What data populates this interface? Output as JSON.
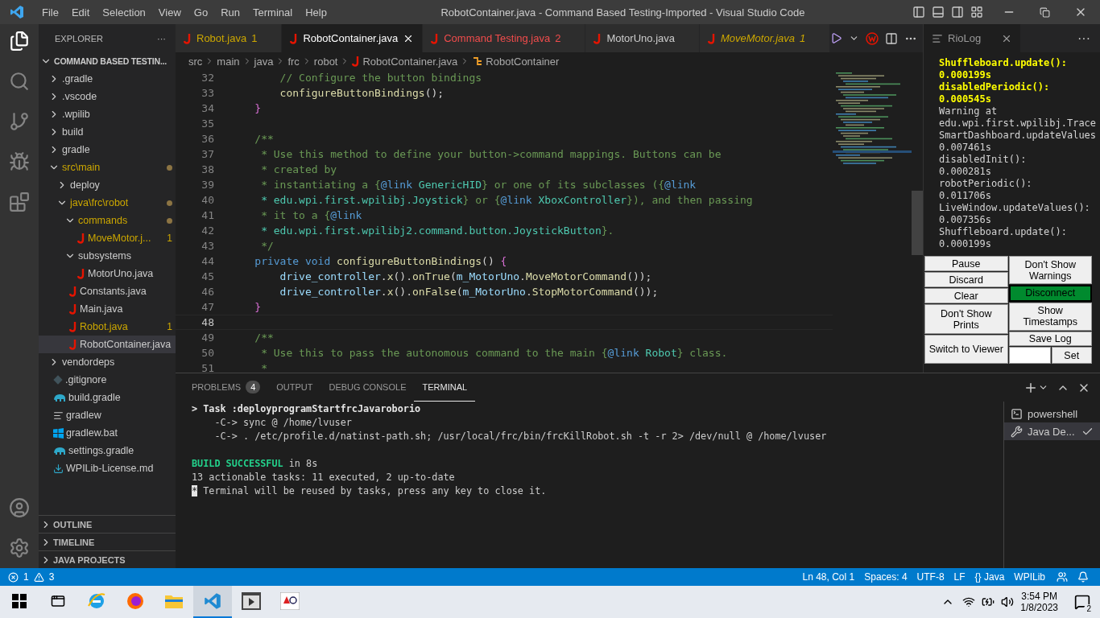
{
  "title_bar": {
    "menus": [
      "File",
      "Edit",
      "Selection",
      "View",
      "Go",
      "Run",
      "Terminal",
      "Help"
    ],
    "title": "RobotContainer.java - Command Based Testing-Imported - Visual Studio Code"
  },
  "explorer": {
    "title": "EXPLORER",
    "more": "···",
    "root": {
      "label": "COMMAND BASED TESTIN...",
      "expanded": true
    },
    "tree": [
      {
        "label": ".gradle",
        "kind": "folder",
        "expanded": false,
        "modified": false,
        "selected": false
      },
      {
        "label": ".vscode",
        "kind": "folder",
        "expanded": false,
        "modified": false,
        "selected": false
      },
      {
        "label": ".wpilib",
        "kind": "folder",
        "expanded": false,
        "modified": false,
        "selected": false
      },
      {
        "label": "build",
        "kind": "folder",
        "expanded": false,
        "modified": false,
        "selected": false
      },
      {
        "label": "gradle",
        "kind": "folder",
        "expanded": false,
        "modified": false,
        "selected": false
      },
      {
        "label": "src\\main",
        "kind": "folder",
        "expanded": true,
        "modified": true,
        "selected": false,
        "children": [
          {
            "label": "deploy",
            "kind": "folder",
            "expanded": false,
            "modified": false,
            "selected": false
          },
          {
            "label": "java\\frc\\robot",
            "kind": "folder",
            "expanded": true,
            "modified": true,
            "selected": false,
            "children": [
              {
                "label": "commands",
                "kind": "folder",
                "expanded": true,
                "modified": true,
                "selected": false,
                "children": [
                  {
                    "label": "MoveMotor.j...",
                    "kind": "java",
                    "modified": true,
                    "badge": "1",
                    "selected": false
                  }
                ]
              },
              {
                "label": "subsystems",
                "kind": "folder",
                "expanded": true,
                "modified": false,
                "selected": false,
                "children": [
                  {
                    "label": "MotorUno.java",
                    "kind": "java",
                    "modified": false,
                    "selected": false
                  }
                ]
              },
              {
                "label": "Constants.java",
                "kind": "java",
                "modified": false,
                "selected": false
              },
              {
                "label": "Main.java",
                "kind": "java",
                "modified": false,
                "selected": false
              },
              {
                "label": "Robot.java",
                "kind": "java",
                "modified": true,
                "badge": "1",
                "selected": false
              },
              {
                "label": "RobotContainer.java",
                "kind": "java",
                "modified": false,
                "selected": true
              }
            ]
          }
        ]
      },
      {
        "label": "vendordeps",
        "kind": "folder",
        "expanded": false,
        "modified": false,
        "selected": false
      },
      {
        "label": ".gitignore",
        "kind": "git",
        "modified": false,
        "selected": false
      },
      {
        "label": "build.gradle",
        "kind": "gradle",
        "modified": false,
        "selected": false
      },
      {
        "label": "gradlew",
        "kind": "text",
        "modified": false,
        "selected": false
      },
      {
        "label": "gradlew.bat",
        "kind": "windows",
        "modified": false,
        "selected": false
      },
      {
        "label": "settings.gradle",
        "kind": "gradle",
        "modified": false,
        "selected": false
      },
      {
        "label": "WPILib-License.md",
        "kind": "download",
        "modified": false,
        "selected": false
      }
    ],
    "sections": [
      {
        "label": "OUTLINE",
        "expanded": false
      },
      {
        "label": "TIMELINE",
        "expanded": false
      },
      {
        "label": "JAVA PROJECTS",
        "expanded": false
      }
    ]
  },
  "tabs": [
    {
      "label": "Robot.java",
      "badge": "1",
      "color": "#cca700",
      "preview": false,
      "selected": false
    },
    {
      "label": "RobotContainer.java",
      "color": "#ffffff",
      "preview": false,
      "selected": true
    },
    {
      "label": "Command Testing.java",
      "badge": "2",
      "color": "#f14c4c",
      "preview": false,
      "selected": false
    },
    {
      "label": "MotorUno.java",
      "color": "#cccccc",
      "preview": false,
      "selected": false
    },
    {
      "label": "MoveMotor.java",
      "badge": "1",
      "color": "#cca700",
      "preview": true,
      "selected": false
    }
  ],
  "breadcrumb": [
    "src",
    "main",
    "java",
    "frc",
    "robot",
    "RobotContainer.java",
    "RobotContainer"
  ],
  "code": [
    {
      "number": "32",
      "current": false,
      "segments": [
        {
          "text": "        // Configure the button bindings",
          "kind": "comment"
        }
      ]
    },
    {
      "number": "33",
      "current": false,
      "segments": [
        {
          "text": "        configureButtonBindings",
          "kind": "method"
        },
        {
          "text": "();",
          "kind": "plain"
        }
      ]
    },
    {
      "number": "34",
      "current": false,
      "segments": [
        {
          "text": "    }",
          "kind": "brace"
        }
      ]
    },
    {
      "number": "35",
      "current": false
    },
    {
      "number": "36",
      "current": false,
      "segments": [
        {
          "text": "    /**",
          "kind": "comment"
        }
      ]
    },
    {
      "number": "37",
      "current": false,
      "segments": [
        {
          "text": "     * Use this method to define your button->command mappings. Buttons can be",
          "kind": "comment"
        }
      ]
    },
    {
      "number": "38",
      "current": false,
      "segments": [
        {
          "text": "     * created by",
          "kind": "comment"
        }
      ]
    },
    {
      "number": "39",
      "current": false,
      "segments": [
        {
          "text": "     * instantiating a {",
          "kind": "comment"
        },
        {
          "text": "@link",
          "kind": "tag"
        },
        {
          "text": " GenericHID",
          "kind": "type"
        },
        {
          "text": "} or one of its subclasses ({",
          "kind": "comment"
        },
        {
          "text": "@link",
          "kind": "tag"
        }
      ]
    },
    {
      "number": "40",
      "current": false,
      "segments": [
        {
          "text": "     * edu.wpi.first.wpilibj.Joystick",
          "kind": "type"
        },
        {
          "text": "} or {",
          "kind": "comment"
        },
        {
          "text": "@link",
          "kind": "tag"
        },
        {
          "text": " XboxController",
          "kind": "type"
        },
        {
          "text": "}), and then passing",
          "kind": "comment"
        }
      ]
    },
    {
      "number": "41",
      "current": false,
      "segments": [
        {
          "text": "     * it to a {",
          "kind": "comment"
        },
        {
          "text": "@link",
          "kind": "tag"
        }
      ]
    },
    {
      "number": "42",
      "current": false,
      "segments": [
        {
          "text": "     * edu.wpi.first.wpilibj2.command.button.JoystickButton",
          "kind": "type"
        },
        {
          "text": "}.",
          "kind": "comment"
        }
      ]
    },
    {
      "number": "43",
      "current": false,
      "segments": [
        {
          "text": "     */",
          "kind": "comment"
        }
      ]
    },
    {
      "number": "44",
      "current": false,
      "segments": [
        {
          "text": "    private void ",
          "kind": "keyword"
        },
        {
          "text": "configureButtonBindings",
          "kind": "method"
        },
        {
          "text": "() ",
          "kind": "plain"
        },
        {
          "text": "{",
          "kind": "brace"
        }
      ]
    },
    {
      "number": "45",
      "current": false,
      "segments": [
        {
          "text": "        drive_controller",
          "kind": "field"
        },
        {
          "text": ".",
          "kind": "plain"
        },
        {
          "text": "x",
          "kind": "method"
        },
        {
          "text": "().",
          "kind": "plain"
        },
        {
          "text": "onTrue",
          "kind": "method"
        },
        {
          "text": "(",
          "kind": "plain"
        },
        {
          "text": "m_MotorUno",
          "kind": "field"
        },
        {
          "text": ".",
          "kind": "plain"
        },
        {
          "text": "MoveMotorCommand",
          "kind": "method"
        },
        {
          "text": "());",
          "kind": "plain"
        }
      ]
    },
    {
      "number": "46",
      "current": false,
      "segments": [
        {
          "text": "        drive_controller",
          "kind": "field"
        },
        {
          "text": ".",
          "kind": "plain"
        },
        {
          "text": "x",
          "kind": "method"
        },
        {
          "text": "().",
          "kind": "plain"
        },
        {
          "text": "onFalse",
          "kind": "method"
        },
        {
          "text": "(",
          "kind": "plain"
        },
        {
          "text": "m_MotorUno",
          "kind": "field"
        },
        {
          "text": ".",
          "kind": "plain"
        },
        {
          "text": "StopMotorCommand",
          "kind": "method"
        },
        {
          "text": "());",
          "kind": "plain"
        }
      ]
    },
    {
      "number": "47",
      "current": false,
      "segments": [
        {
          "text": "    }",
          "kind": "brace"
        }
      ]
    },
    {
      "number": "48",
      "current": true
    },
    {
      "number": "49",
      "current": false,
      "segments": [
        {
          "text": "    /**",
          "kind": "comment"
        }
      ]
    },
    {
      "number": "50",
      "current": false,
      "segments": [
        {
          "text": "     * Use this to pass the autonomous command to the main {",
          "kind": "comment"
        },
        {
          "text": "@link",
          "kind": "tag"
        },
        {
          "text": " Robot",
          "kind": "type"
        },
        {
          "text": "} class.",
          "kind": "comment"
        }
      ]
    },
    {
      "number": "51",
      "current": false,
      "segments": [
        {
          "text": "     *",
          "kind": "comment"
        }
      ]
    }
  ],
  "riolog": {
    "title": "RioLog",
    "more": "···",
    "lines": [
      {
        "text": "Shuffleboard.update():",
        "highlight": true
      },
      {
        "text": "0.000199s",
        "highlight": true
      },
      {
        "text": "disabledPeriodic():",
        "highlight": true
      },
      {
        "text": "0.000545s",
        "highlight": true
      },
      {
        "text": "Warning at",
        "highlight": false
      },
      {
        "text": "edu.wpi.first.wpilibj.Trace",
        "highlight": false
      },
      {
        "text": "SmartDashboard.updateValues",
        "highlight": false
      },
      {
        "text": "0.007461s",
        "highlight": false
      },
      {
        "text": "disabledInit():",
        "highlight": false
      },
      {
        "text": "0.000281s",
        "highlight": false
      },
      {
        "text": "robotPeriodic():",
        "highlight": false
      },
      {
        "text": "0.011706s",
        "highlight": false
      },
      {
        "text": "LiveWindow.updateValues():",
        "highlight": false
      },
      {
        "text": "0.007356s",
        "highlight": false
      },
      {
        "text": "Shuffleboard.update():",
        "highlight": false
      },
      {
        "text": "0.000199s",
        "highlight": false
      }
    ],
    "left_buttons": [
      "Pause",
      "Discard",
      "Clear",
      "Don't Show Prints",
      "Switch to Viewer"
    ],
    "right_buttons": [
      {
        "label": "Don't Show Warnings",
        "kind": "plain"
      },
      {
        "label": "Disconnect",
        "kind": "connection",
        "connected": true
      },
      {
        "label": "Show Timestamps",
        "kind": "plain"
      },
      {
        "label": "Save Log",
        "kind": "plain"
      }
    ],
    "set_button": "Set"
  },
  "panel": {
    "tabs": [
      {
        "label": "PROBLEMS",
        "badge": "4",
        "selected": false
      },
      {
        "label": "OUTPUT",
        "selected": false
      },
      {
        "label": "DEBUG CONSOLE",
        "selected": false
      },
      {
        "label": "TERMINAL",
        "selected": true
      }
    ],
    "terminal": [
      {
        "lines": [
          {
            "segments": [
              {
                "text": "> Task :deployprogramStartfrcJavaroborio",
                "kind": "bold"
              }
            ]
          },
          {
            "segments": [
              {
                "text": "    -C-> sync @ /home/lvuser",
                "kind": "plain"
              }
            ]
          },
          {
            "segments": [
              {
                "text": "    -C-> . /etc/profile.d/natinst-path.sh; /usr/local/frc/bin/frcKillRobot.sh -t -r 2> /dev/null @ /home/lvuser",
                "kind": "plain"
              }
            ]
          }
        ]
      },
      {
        "lines": [
          {
            "segments": [
              {
                "text": "BUILD SUCCESSFUL",
                "kind": "success"
              },
              {
                "text": " in 8s",
                "kind": "plain"
              }
            ]
          },
          {
            "segments": [
              {
                "text": "13 actionable tasks: 11 executed, 2 up-to-date",
                "kind": "plain"
              }
            ]
          },
          {
            "segments": [
              {
                "text": "*",
                "kind": "marker"
              },
              {
                "text": " Terminal will be reused by tasks, press any key to close it.",
                "kind": "plain"
              }
            ]
          }
        ]
      }
    ],
    "terminals": [
      {
        "label": "powershell",
        "kind": "shell",
        "selected": false
      },
      {
        "label": "Java De...",
        "kind": "task",
        "selected": true
      }
    ]
  },
  "status_bar": {
    "errors": "1",
    "warnings": "3",
    "items": [
      "Ln 48, Col 1",
      "Spaces: 4",
      "UTF-8",
      "LF",
      "{} Java",
      "WPILib"
    ]
  },
  "taskbar": {
    "time": "3:54 PM",
    "date": "1/8/2023",
    "notifications": "2"
  }
}
